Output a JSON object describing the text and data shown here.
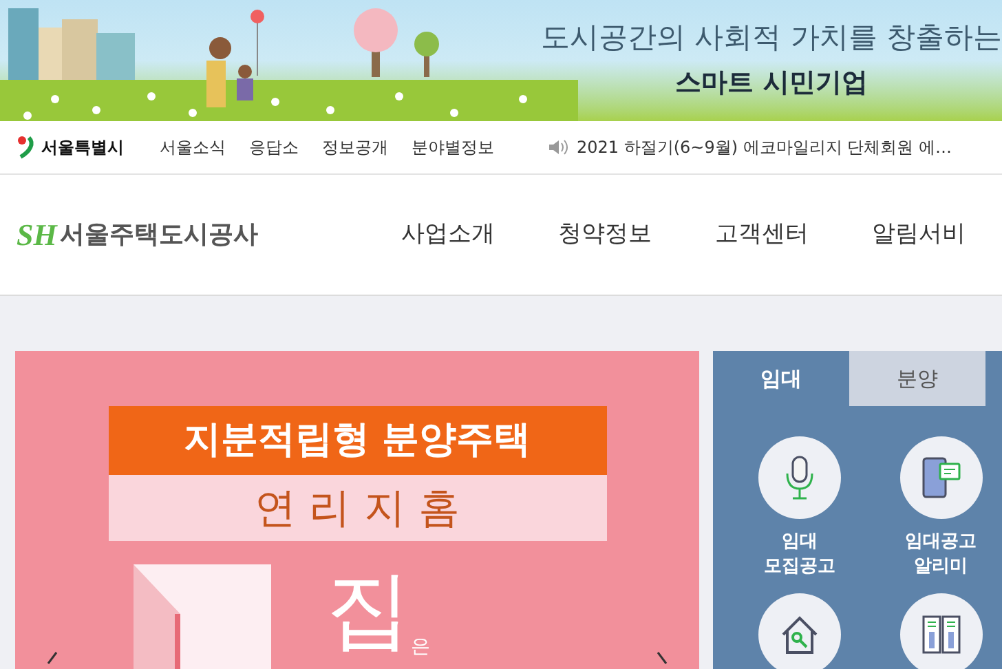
{
  "banner": {
    "headline": "도시공간의 사회적 가치를 창출하는",
    "tagline": "스마트 시민기업"
  },
  "top_bar": {
    "city_logo": "서울특별시",
    "links": [
      "서울소식",
      "응답소",
      "정보공개",
      "분야별정보"
    ],
    "notice": "2021 하절기(6~9월) 에코마일리지 단체회원 에…"
  },
  "header": {
    "logo_mark": "SH",
    "logo_text": "서울주택도시공사",
    "nav": [
      "사업소개",
      "청약정보",
      "고객센터",
      "알림서비"
    ]
  },
  "hero": {
    "title": "지분적립형 분양주택",
    "subtitle": "연 리 지 홈",
    "big_text": "집",
    "small_text": "은"
  },
  "panel": {
    "tabs": [
      {
        "label": "임대",
        "selected": true
      },
      {
        "label": "분양",
        "selected": false
      }
    ],
    "items": [
      {
        "kind": "microphone",
        "label": "임대\n모집공고"
      },
      {
        "kind": "phone",
        "label": "임대공고\n알리미"
      },
      {
        "kind": "house"
      },
      {
        "kind": "book"
      }
    ]
  }
}
